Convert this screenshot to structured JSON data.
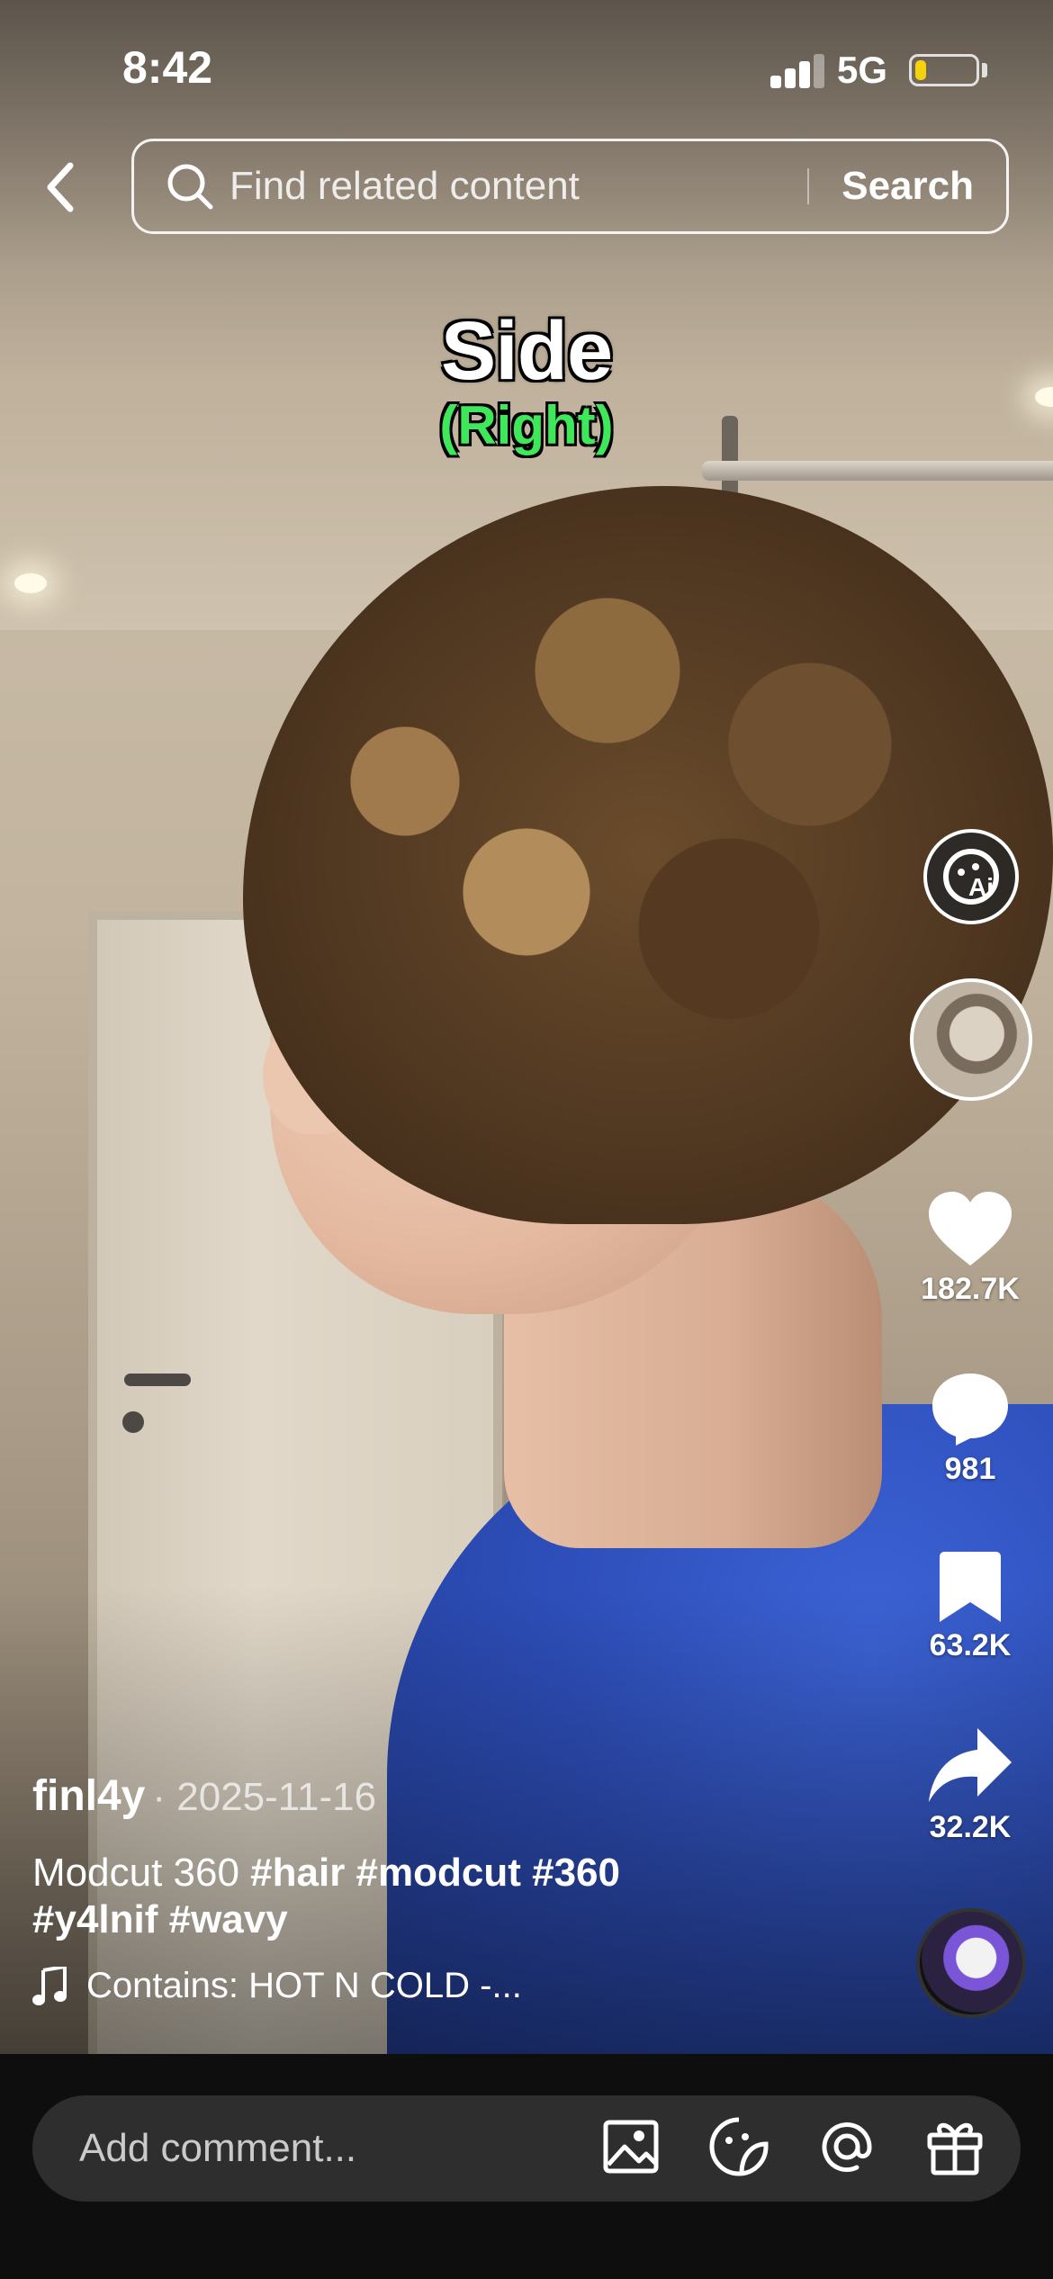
{
  "status_bar": {
    "time": "8:42",
    "network": "5G",
    "battery_level": 0.18
  },
  "header": {
    "search_placeholder": "Find related content",
    "search_button": "Search"
  },
  "video": {
    "overlay_title": "Side",
    "overlay_subtitle": "(Right)"
  },
  "actions": {
    "likes": "182.7K",
    "comments": "981",
    "saves": "63.2K",
    "shares": "32.2K"
  },
  "post": {
    "author": "finl4y",
    "date": "· 2025-11-16",
    "description_text": "Modcut 360 ",
    "description_tags_line1": "#hair #modcut #360",
    "description_tags_line2": "#y4lnif #wavy",
    "music": "Contains: HOT N COLD -..."
  },
  "comment_bar": {
    "placeholder": "Add comment..."
  },
  "icons": [
    "back-icon",
    "search-icon",
    "ai-icon",
    "heart-icon",
    "comment-icon",
    "bookmark-icon",
    "share-icon",
    "music-note-icon",
    "image-icon",
    "sticker-icon",
    "mention-icon",
    "gift-icon"
  ]
}
